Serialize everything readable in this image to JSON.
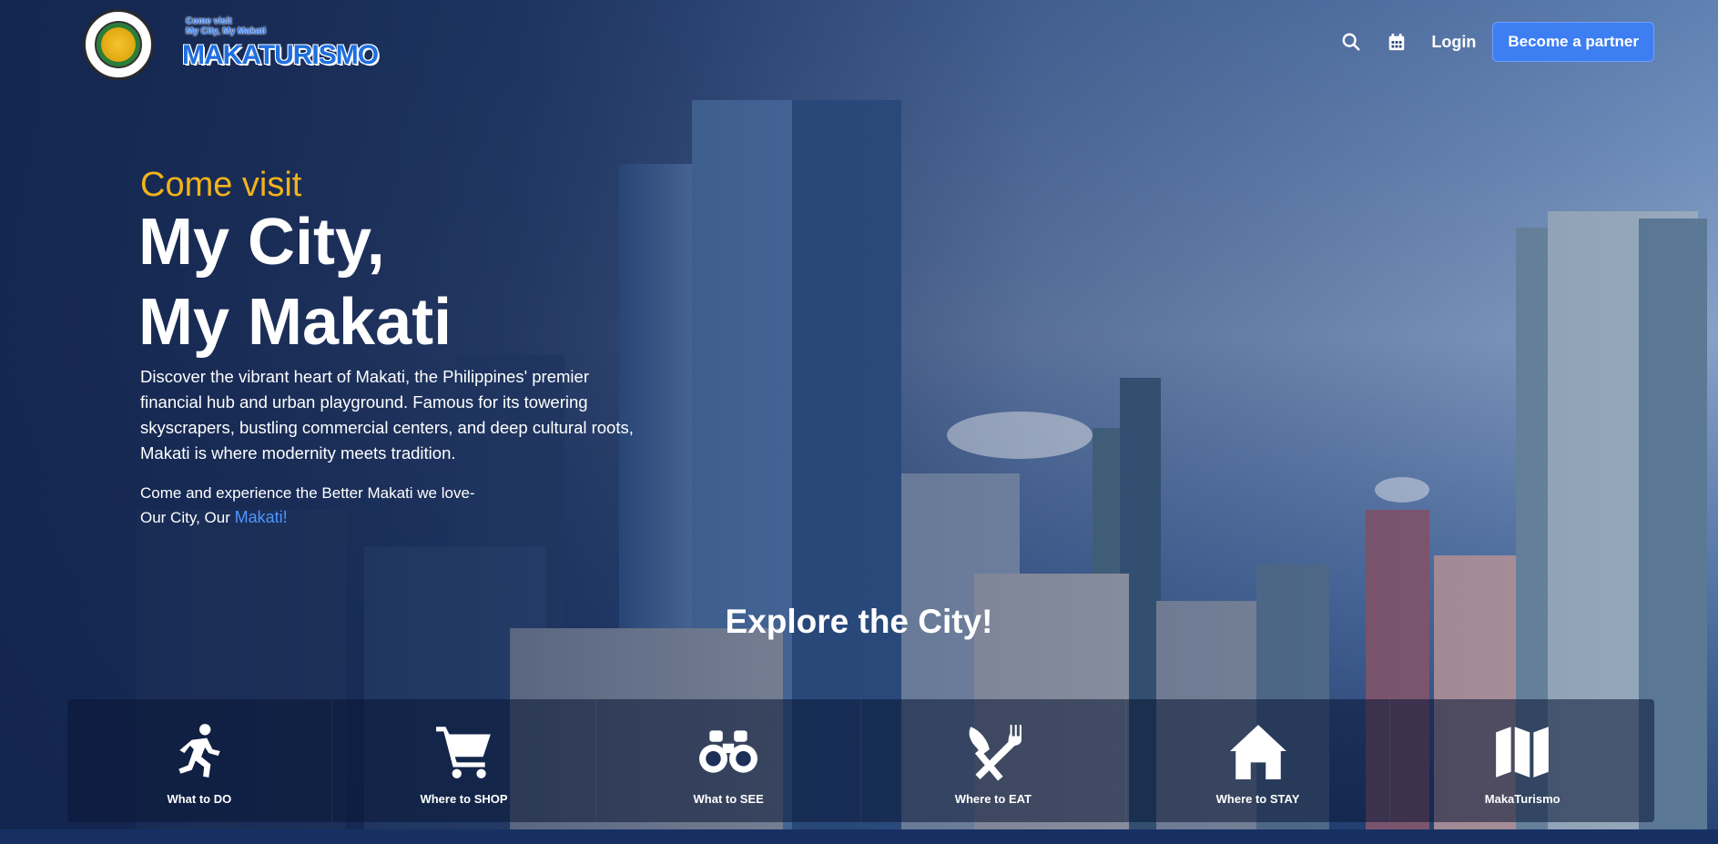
{
  "brand": {
    "seal_text": "LUNGSOD NG MAKATI PILIPINAS 1986",
    "tagline_line1": "Come visit",
    "tagline_line2": "My City, My Makati",
    "wordmark": "MAKATURISMO"
  },
  "nav": {
    "search_icon": "search-icon",
    "calendar_icon": "calendar-icon",
    "login_label": "Login",
    "partner_label": "Become a partner"
  },
  "hero": {
    "eyebrow": "Come visit",
    "headline_line1": "My City,",
    "headline_line2": "My Makati",
    "description": "Discover the vibrant heart of Makati, the Philippines' premier financial hub and urban playground. Famous for its towering skyscrapers, bustling commercial centers, and deep cultural roots, Makati is where modernity meets tradition.",
    "tagline_line1": "Come and experience the Better Makati we love-",
    "tagline_line2_prefix": "Our City, Our ",
    "tagline_accent": "Makati!"
  },
  "explore": {
    "title": "Explore the City!",
    "categories": [
      {
        "label": "What to DO",
        "icon": "running-person-icon"
      },
      {
        "label": "Where to SHOP",
        "icon": "shopping-cart-icon"
      },
      {
        "label": "What to SEE",
        "icon": "binoculars-icon"
      },
      {
        "label": "Where to EAT",
        "icon": "utensils-icon"
      },
      {
        "label": "Where to STAY",
        "icon": "house-icon"
      },
      {
        "label": "MakaTurismo",
        "icon": "map-icon"
      }
    ]
  },
  "colors": {
    "accent_gold": "#f2b21a",
    "primary_blue": "#3d7ef2",
    "link_blue": "#4f95ff"
  }
}
